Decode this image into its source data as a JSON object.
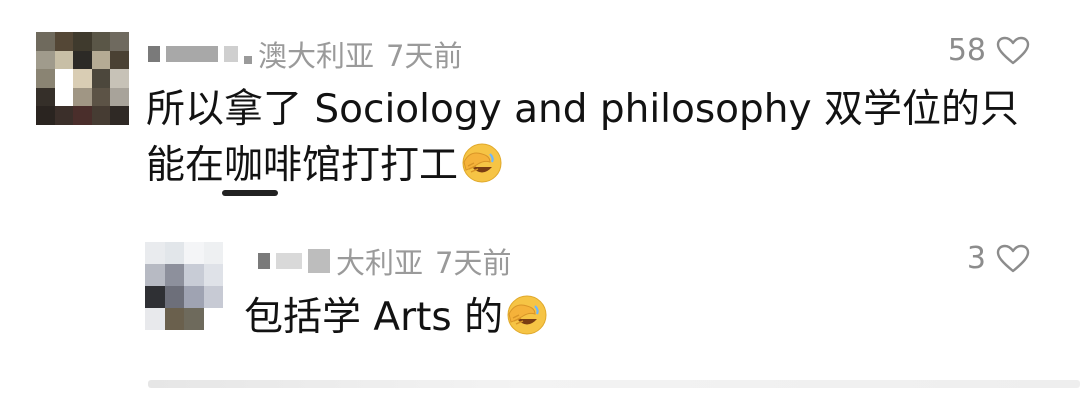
{
  "comments": [
    {
      "location": "澳大利亚",
      "time": "7天前",
      "text": "所以拿了 Sociology and philosophy 双学位的只能在咖啡馆打打工",
      "emoji": "face-palm-emoji",
      "likes": "58",
      "avatar_colors": [
        "#6f6a5d",
        "#544736",
        "#3f3a2d",
        "#5a5647",
        "#6f6a5f",
        "#a09b8c",
        "#c8bfa6",
        "#2c2a26",
        "#b5ab94",
        "#4a4133",
        "#8a8473",
        "#ffffff",
        "#d9cdb4",
        "#4c473c",
        "#c7c2b7",
        "#352f29",
        "#ffffff",
        "#a09684",
        "#5c5346",
        "#a8a39a",
        "#2a2420",
        "#3b2f2a",
        "#4a2e2b",
        "#463c33",
        "#2f2925"
      ]
    },
    {
      "location": "大利亚",
      "time": "7天前",
      "text": "包括学 Arts 的",
      "emoji": "face-palm-emoji",
      "likes": "3",
      "avatar_colors": [
        "#e9ebee",
        "#e2e6ea",
        "#f4f5f7",
        "#eef0f2",
        "#b7bac3",
        "#8d909c",
        "#c8ccd6",
        "#dfe2e8",
        "#2f3034",
        "#6d6f7a",
        "#9fa3b2",
        "#c7cad4",
        "#e8e9ec",
        "#6a604d",
        "#6e6a5c",
        "#ffffff"
      ]
    }
  ]
}
